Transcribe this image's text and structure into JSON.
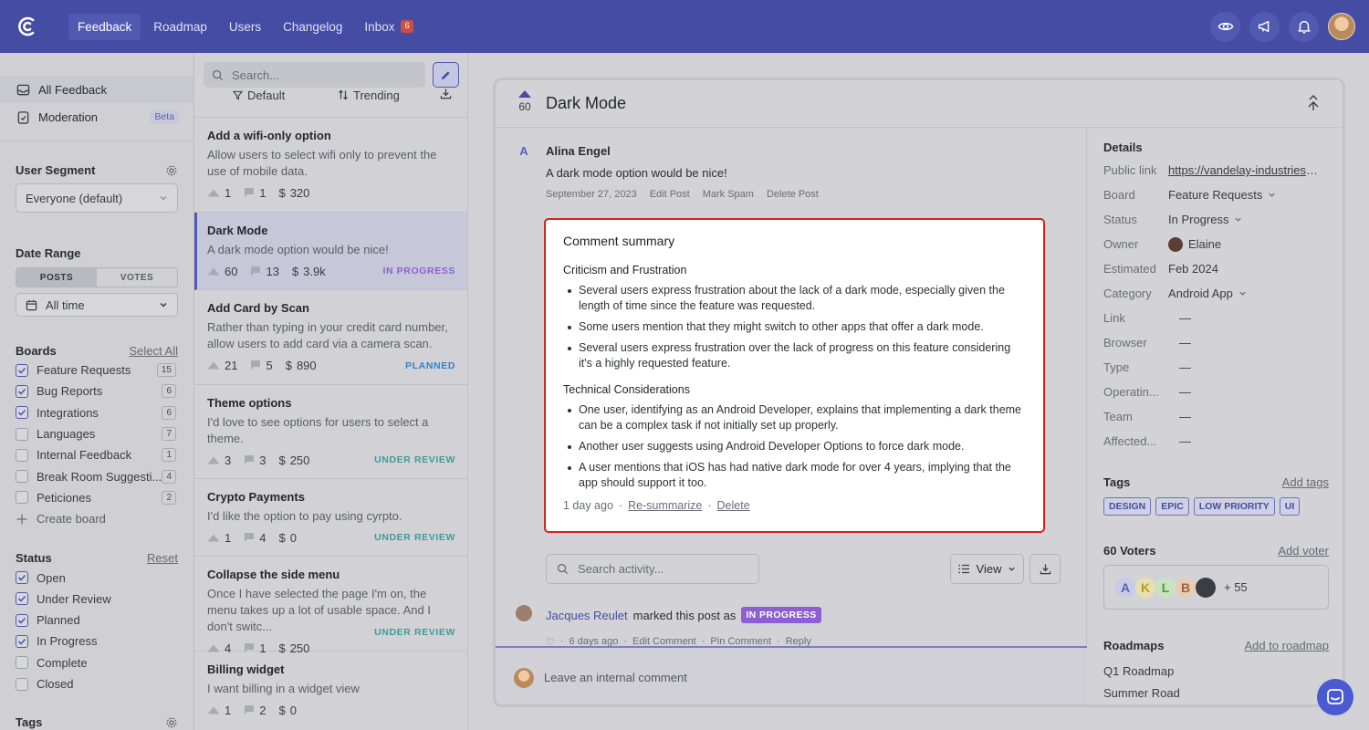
{
  "nav": {
    "items": [
      {
        "label": "Feedback",
        "active": true
      },
      {
        "label": "Roadmap"
      },
      {
        "label": "Users"
      },
      {
        "label": "Changelog"
      },
      {
        "label": "Inbox",
        "badge": "6"
      }
    ]
  },
  "sidebar": {
    "all_feedback": "All Feedback",
    "moderation": "Moderation",
    "beta": "Beta",
    "user_segment_title": "User Segment",
    "user_segment_value": "Everyone (default)",
    "date_range_title": "Date Range",
    "seg_posts": "POSTS",
    "seg_votes": "VOTES",
    "date_value": "All time",
    "boards_title": "Boards",
    "select_all": "Select All",
    "boards": [
      {
        "label": "Feature Requests",
        "count": "15",
        "checked": true
      },
      {
        "label": "Bug Reports",
        "count": "6",
        "checked": true
      },
      {
        "label": "Integrations",
        "count": "6",
        "checked": true
      },
      {
        "label": "Languages",
        "count": "7",
        "checked": false
      },
      {
        "label": "Internal Feedback",
        "count": "1",
        "checked": false
      },
      {
        "label": "Break Room Suggesti...",
        "count": "4",
        "checked": false
      },
      {
        "label": "Peticiones",
        "count": "2",
        "checked": false
      }
    ],
    "create_board": "Create board",
    "status_title": "Status",
    "reset": "Reset",
    "statuses": [
      {
        "label": "Open",
        "checked": true
      },
      {
        "label": "Under Review",
        "checked": true
      },
      {
        "label": "Planned",
        "checked": true
      },
      {
        "label": "In Progress",
        "checked": true
      },
      {
        "label": "Complete",
        "checked": false
      },
      {
        "label": "Closed",
        "checked": false
      }
    ],
    "tags_title": "Tags"
  },
  "list": {
    "search_placeholder": "Search...",
    "filter_default": "Default",
    "filter_trending": "Trending",
    "posts": [
      {
        "title": "Add a wifi-only option",
        "desc": "Allow users to select wifi only to prevent the use of mobile data.",
        "votes": "1",
        "comments": "1",
        "value": "320",
        "status": "",
        "status_color": ""
      },
      {
        "title": "Dark Mode",
        "desc": "A dark mode option would be nice!",
        "votes": "60",
        "comments": "13",
        "value": "3.9k",
        "status": "IN PROGRESS",
        "status_color": "#8d5fd3",
        "selected": true
      },
      {
        "title": "Add Card by Scan",
        "desc": "Rather than typing in your credit card number, allow users to add card via a camera scan.",
        "votes": "21",
        "comments": "5",
        "value": "890",
        "status": "PLANNED",
        "status_color": "#2f82c9"
      },
      {
        "title": "Theme options",
        "desc": "I'd love to see options for users to select a theme.",
        "votes": "3",
        "comments": "3",
        "value": "250",
        "status": "UNDER REVIEW",
        "status_color": "#3e9b99"
      },
      {
        "title": "Crypto Payments",
        "desc": "I'd like the option to pay using cyrpto.",
        "votes": "1",
        "comments": "4",
        "value": "0",
        "status": "UNDER REVIEW",
        "status_color": "#3e9b99"
      },
      {
        "title": "Collapse the side menu",
        "desc": "Once I have selected the page I'm on, the menu takes up a lot of usable space. And I don't switc...",
        "votes": "4",
        "comments": "1",
        "value": "250",
        "status": "UNDER REVIEW",
        "status_color": "#3e9b99"
      },
      {
        "title": "Billing widget",
        "desc": "I want billing in a widget view",
        "votes": "1",
        "comments": "2",
        "value": "0",
        "status": "",
        "status_color": ""
      }
    ]
  },
  "detail": {
    "votes": "60",
    "title": "Dark Mode",
    "author": "Alina Engel",
    "author_initial": "A",
    "body": "A dark mode option would be nice!",
    "date": "September 27, 2023",
    "edit_post": "Edit Post",
    "mark_spam": "Mark Spam",
    "delete_post": "Delete Post",
    "activity_placeholder": "Search activity...",
    "view": "View",
    "activity_user": "Jacques Reulet",
    "activity_text": "marked this post as",
    "activity_status": "IN PROGRESS",
    "activity_time": "6 days ago",
    "edit_comment": "Edit Comment",
    "pin_comment": "Pin Comment",
    "reply": "Reply",
    "comment_placeholder": "Leave an internal comment"
  },
  "summary": {
    "title": "Comment summary",
    "sections": [
      {
        "heading": "Criticism and Frustration",
        "items": [
          "Several users express frustration about the lack of a dark mode, especially given the length of time since the feature was requested.",
          "Some users mention that they might switch to other apps that offer a dark mode.",
          "Several users express frustration over the lack of progress on this feature considering it's a highly requested feature."
        ]
      },
      {
        "heading": "Technical Considerations",
        "items": [
          "One user, identifying as an Android Developer, explains that implementing a dark theme can be a complex task if not initially set up properly.",
          "Another user suggests using Android Developer Options to force dark mode.",
          "A user mentions that iOS has had native dark mode for over 4 years, implying that the app should support it too."
        ]
      }
    ],
    "time": "1 day ago",
    "resummarize": "Re-summarize",
    "delete": "Delete"
  },
  "details_panel": {
    "title": "Details",
    "rows": [
      {
        "label": "Public link",
        "value": "https://vandelay-industries....",
        "link": true
      },
      {
        "label": "Board",
        "value": "Feature Requests",
        "chevron": true
      },
      {
        "label": "Status",
        "value": "In Progress",
        "chevron": true
      },
      {
        "label": "Owner",
        "value": "Elaine",
        "avatar": true
      },
      {
        "label": "Estimated",
        "value": "Feb 2024"
      },
      {
        "label": "Category",
        "value": "Android App",
        "chevron": true
      },
      {
        "label": "Link",
        "value": "—"
      },
      {
        "label": "Browser",
        "value": "—"
      },
      {
        "label": "Type",
        "value": "—"
      },
      {
        "label": "Operatin...",
        "value": "—"
      },
      {
        "label": "Team",
        "value": "—"
      },
      {
        "label": "Affected...",
        "value": "—"
      }
    ],
    "tags_title": "Tags",
    "add_tags": "Add tags",
    "tags": [
      "DESIGN",
      "EPIC",
      "LOW PRIORITY",
      "UI"
    ],
    "voters_title": "60 Voters",
    "add_voter": "Add voter",
    "voters": [
      "A",
      "K",
      "L",
      "B"
    ],
    "voters_more": "+ 55",
    "roadmaps_title": "Roadmaps",
    "add_to_roadmap": "Add to roadmap",
    "roadmap_item": "Q1 Roadmap",
    "roadmap_item_2": "Summer Road"
  },
  "colors": {
    "accent": "#454ca4",
    "highlight": "#d8201e"
  }
}
